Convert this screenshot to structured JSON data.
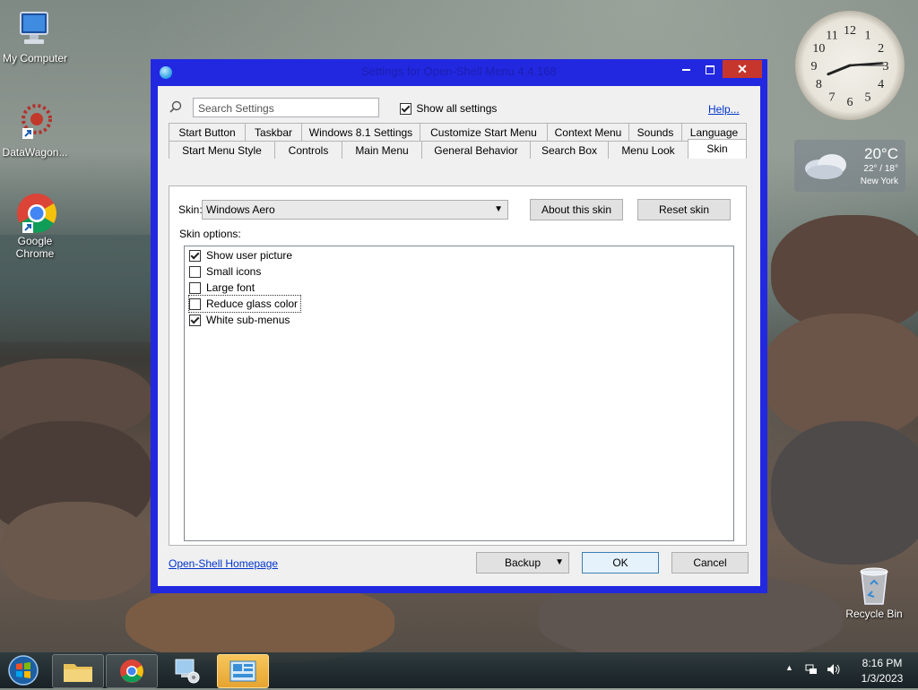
{
  "desktop": {
    "icons": [
      {
        "label": "My Computer"
      },
      {
        "label": "DataWagon..."
      },
      {
        "label": "Google Chrome"
      },
      {
        "label": "Recycle Bin"
      }
    ],
    "weather": {
      "temp": "20°C",
      "range": "22° / 18°",
      "city": "New York"
    },
    "clock": {
      "numbers": [
        "12",
        "1",
        "2",
        "3",
        "4",
        "5",
        "6",
        "7",
        "8",
        "9",
        "10",
        "11"
      ]
    }
  },
  "window": {
    "title": "Settings for Open-Shell Menu 4.4.168",
    "search_placeholder": "Search Settings",
    "show_all_label": "Show all settings",
    "show_all_checked": true,
    "help_link": "Help...",
    "tabs_row1": [
      "Start Button",
      "Taskbar",
      "Windows 8.1 Settings",
      "Customize Start Menu",
      "Context Menu",
      "Sounds",
      "Language"
    ],
    "tabs_row2": [
      "Start Menu Style",
      "Controls",
      "Main Menu",
      "General Behavior",
      "Search Box",
      "Menu Look",
      "Skin"
    ],
    "selected_tab": "Skin",
    "skin": {
      "skin_label": "Skin:",
      "skin_value": "Windows Aero",
      "about_button": "About this skin",
      "reset_button": "Reset skin",
      "options_label": "Skin options:",
      "options": [
        {
          "label": "Show user picture",
          "checked": true
        },
        {
          "label": "Small icons",
          "checked": false
        },
        {
          "label": "Large font",
          "checked": false
        },
        {
          "label": "Reduce glass color",
          "checked": false
        },
        {
          "label": "White sub-menus",
          "checked": true
        }
      ]
    },
    "footer": {
      "homepage_link": "Open-Shell Homepage",
      "backup_button": "Backup",
      "ok_button": "OK",
      "cancel_button": "Cancel"
    }
  },
  "taskbar": {
    "time": "8:16 PM",
    "date": "1/3/2023"
  },
  "colors": {
    "window_frame": "#2228e0",
    "close_button": "#c7362c",
    "link": "#0033cc"
  }
}
